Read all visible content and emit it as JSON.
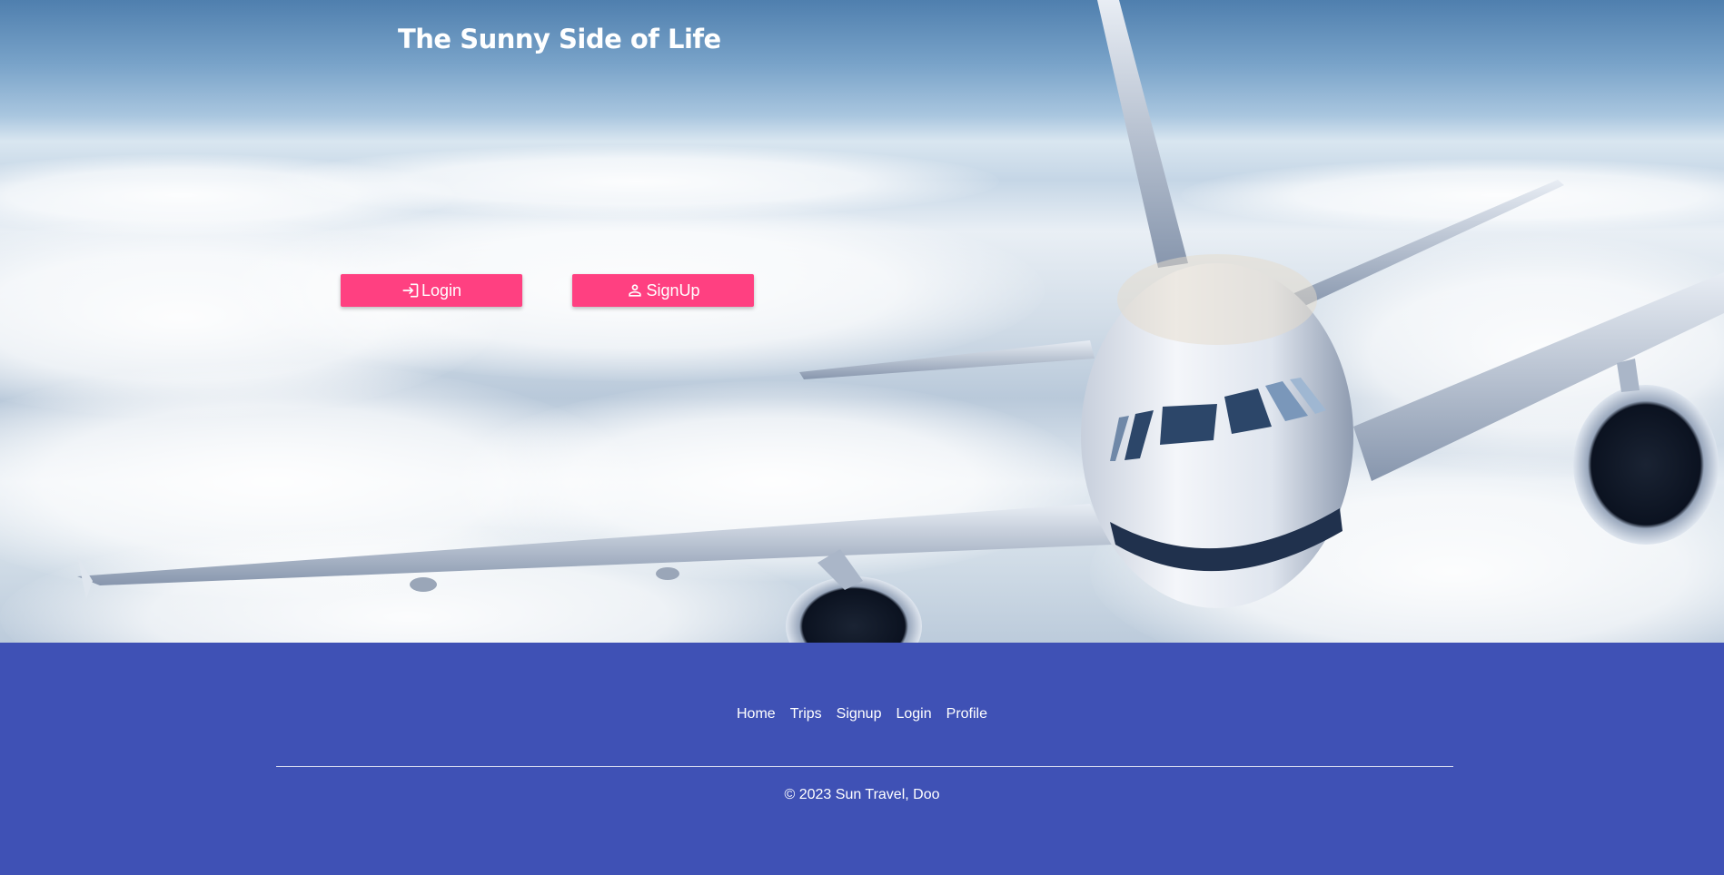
{
  "header": {
    "title": "The Sunny Side of Life"
  },
  "hero": {
    "login_label": "Login",
    "signup_label": "SignUp",
    "login_icon": "login-icon",
    "signup_icon": "person-icon",
    "button_color": "#ff4081"
  },
  "footer": {
    "background_color": "#3f51b5",
    "nav": [
      {
        "label": "Home"
      },
      {
        "label": "Trips"
      },
      {
        "label": "Signup"
      },
      {
        "label": "Login"
      },
      {
        "label": "Profile"
      }
    ],
    "copyright": "© 2023 Sun Travel, Doo"
  }
}
